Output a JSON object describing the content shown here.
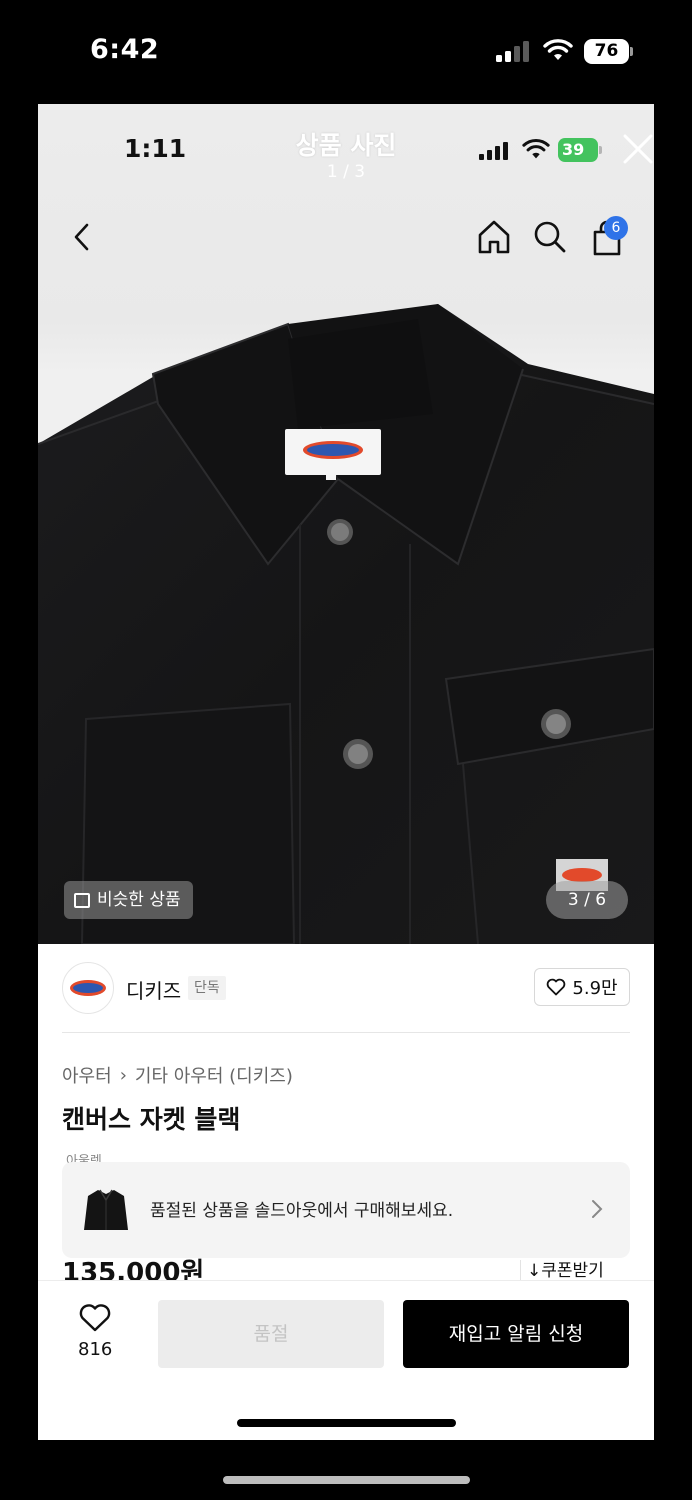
{
  "outer_status": {
    "time": "6:42",
    "battery": "76"
  },
  "photo_header": {
    "inner_time": "1:11",
    "title": "상품 사진",
    "counter": "1 / 3",
    "inner_battery": "39"
  },
  "nav": {
    "cart_badge": "6"
  },
  "photo": {
    "similar_label": "비슷한 상품",
    "pager": "3 / 6"
  },
  "brand": {
    "name": "디키즈",
    "tag": "단독",
    "likes": "5.9만"
  },
  "breadcrumb": {
    "level1": "아우터",
    "separator": "›",
    "level2": "기타 아우터 (디키즈)"
  },
  "product": {
    "name": "캔버스 자켓 블랙",
    "clipped_tag": "아울렛",
    "price": "135,000원",
    "coupon_label": "쿠폰받기"
  },
  "soldout_banner": {
    "text": "품절된 상품을 솔드아웃에서 구매해보세요."
  },
  "bottom_bar": {
    "wish_count": "816",
    "soldout_label": "품절",
    "restock_label": "재입고 알림 신청"
  },
  "colors": {
    "accent_badge": "#2f73e8",
    "battery_green": "#43c35e",
    "primary_button": "#000000",
    "disabled_button": "#ececec"
  },
  "icons": [
    "back-icon",
    "home-icon",
    "search-icon",
    "cart-icon",
    "close-icon",
    "heart-icon",
    "chevron-right-icon",
    "download-icon"
  ]
}
